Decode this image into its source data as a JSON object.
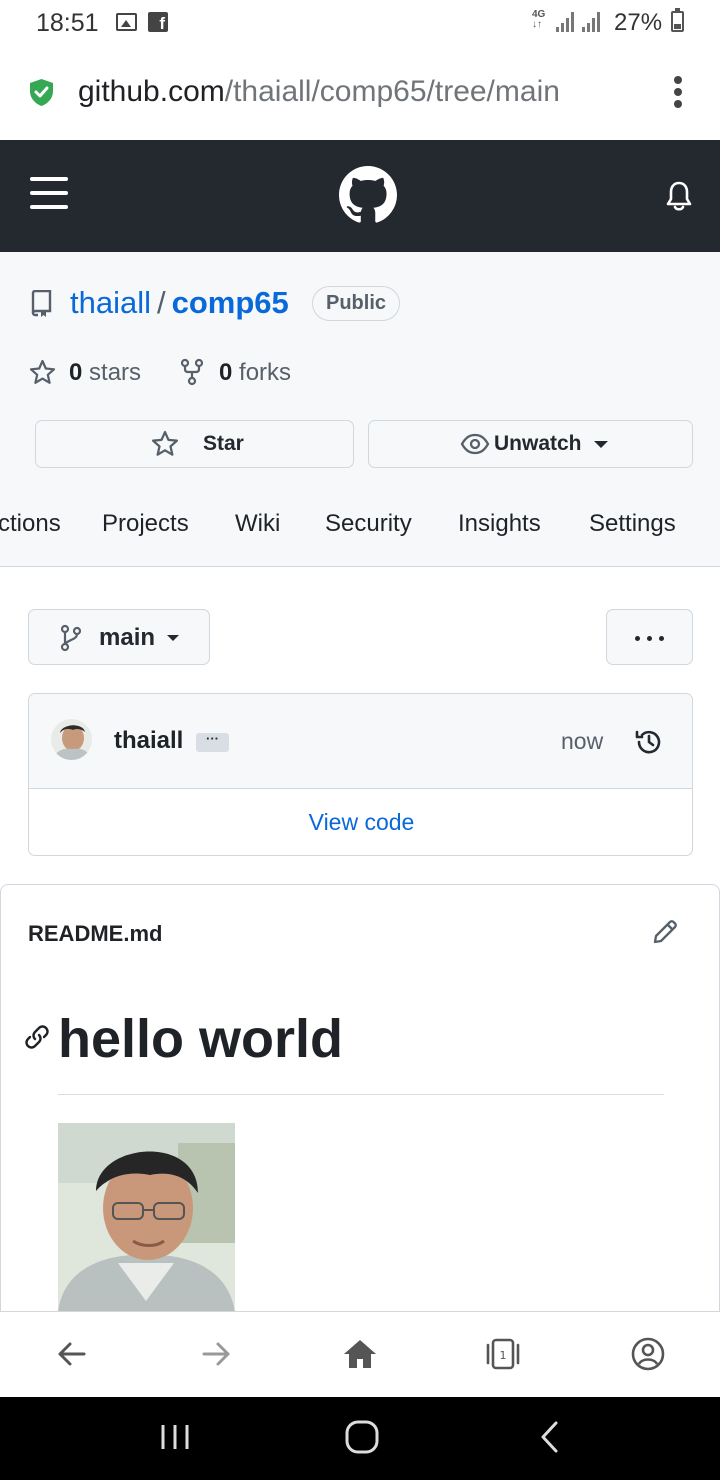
{
  "status_bar": {
    "time": "18:51",
    "network": "4G",
    "battery_percent": "27%"
  },
  "browser": {
    "url_domain": "github.com",
    "url_path": "/thaiall/comp65/tree/main"
  },
  "repo": {
    "owner": "thaiall",
    "separator": "/",
    "name": "comp65",
    "visibility": "Public",
    "stars_count": "0",
    "stars_label": "stars",
    "forks_count": "0",
    "forks_label": "forks",
    "star_button": "Star",
    "watch_button": "Unwatch"
  },
  "tabs": [
    "ctions",
    "Projects",
    "Wiki",
    "Security",
    "Insights",
    "Settings"
  ],
  "branch": {
    "name": "main"
  },
  "commit": {
    "author": "thaiall",
    "ellipsis": "···",
    "time": "now",
    "view_code": "View code"
  },
  "readme": {
    "filename": "README.md",
    "heading": "hello world"
  },
  "colors": {
    "github_header": "#24292f",
    "link_blue": "#0969da",
    "secure_green": "#34a853"
  }
}
